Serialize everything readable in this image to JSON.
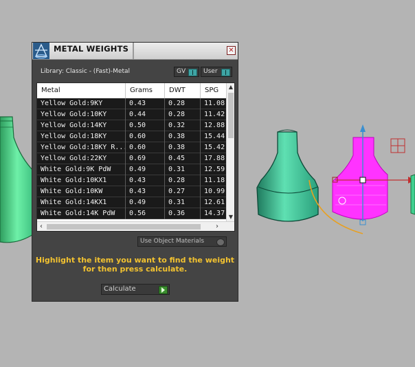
{
  "panel": {
    "title": "METAL WEIGHTS",
    "close_symbol": "✕",
    "library_label": "Library: Classic - (Fast)-Metal",
    "toggles": [
      {
        "label": "GV",
        "state": "on"
      },
      {
        "label": "User",
        "state": "on"
      }
    ],
    "table": {
      "columns": [
        "Metal",
        "Grams",
        "DWT",
        "SPG"
      ],
      "rows": [
        [
          "Yellow Gold:9KY",
          "0.43",
          "0.28",
          "11.08"
        ],
        [
          "Yellow Gold:10KY",
          "0.44",
          "0.28",
          "11.42"
        ],
        [
          "Yellow Gold:14KY",
          "0.50",
          "0.32",
          "12.88"
        ],
        [
          "Yellow Gold:18KY",
          "0.60",
          "0.38",
          "15.44"
        ],
        [
          "Yellow Gold:18KY R...",
          "0.60",
          "0.38",
          "15.42"
        ],
        [
          "Yellow Gold:22KY",
          "0.69",
          "0.45",
          "17.88"
        ],
        [
          "White Gold:9K PdW",
          "0.49",
          "0.31",
          "12.59"
        ],
        [
          "White Gold:10KX1",
          "0.43",
          "0.28",
          "11.18"
        ],
        [
          "White Gold:10KW",
          "0.43",
          "0.27",
          "10.99"
        ],
        [
          "White Gold:14KX1",
          "0.49",
          "0.31",
          "12.61"
        ],
        [
          "White Gold:14K PdW",
          "0.56",
          "0.36",
          "14.37"
        ]
      ]
    },
    "use_object_materials_label": "Use Object Materials",
    "hint_line1": "Highlight the item you want to find the weight",
    "hint_line2": "for then press calculate.",
    "calculate_label": "Calculate"
  },
  "colors": {
    "panel_bg": "#444444",
    "hint_text": "#f2c230",
    "toggle_accent": "#3ea5a5",
    "viewport_bg": "#b4b4b4",
    "green_model": "#3fcf8f",
    "teal_model": "#2fae86",
    "magenta_model": "#ff33ff"
  },
  "icons": [
    "metal-weights-icon",
    "close-icon",
    "gizmo-cross-icon"
  ]
}
